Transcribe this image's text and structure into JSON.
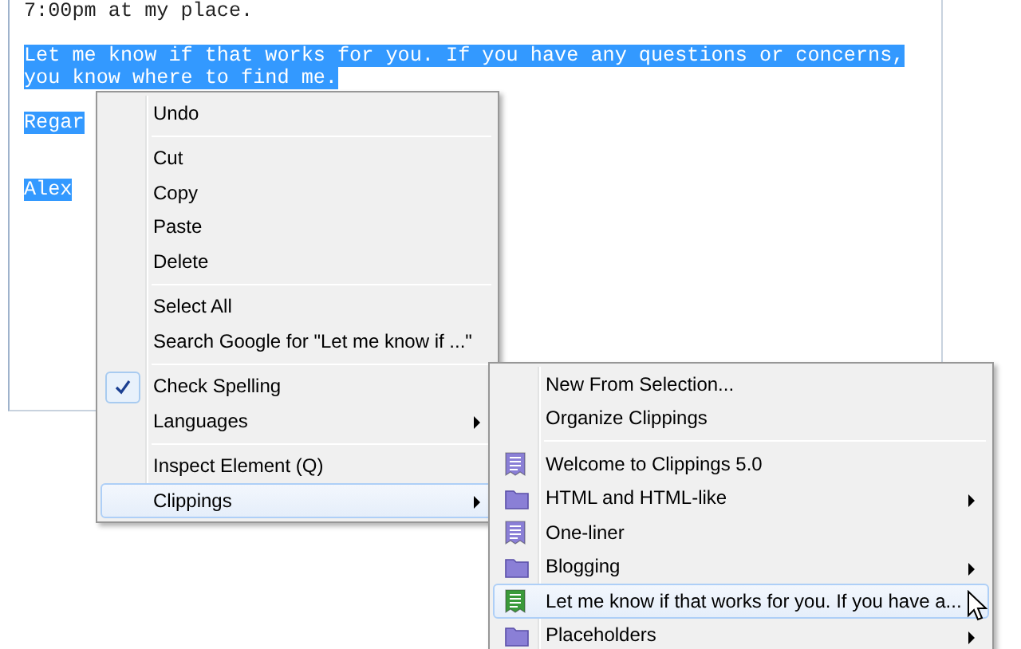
{
  "editor": {
    "lines": [
      {
        "kind": "text",
        "text": "7:00pm at my place.",
        "selected": false
      },
      {
        "kind": "blank"
      },
      {
        "kind": "text",
        "text": "Let me know if that works for you. If you have any questions or concerns,",
        "selected": true
      },
      {
        "kind": "text",
        "text": "you know where to find me.",
        "selected": true
      },
      {
        "kind": "blank"
      },
      {
        "kind": "text",
        "text": "Regar",
        "selected": true
      },
      {
        "kind": "blank"
      },
      {
        "kind": "blank"
      },
      {
        "kind": "text",
        "text": "Alex",
        "selected": true
      }
    ]
  },
  "context_menu": {
    "items": [
      {
        "kind": "item",
        "label": "Undo",
        "checked": false,
        "submenu": false,
        "selected": false
      },
      {
        "kind": "separator"
      },
      {
        "kind": "item",
        "label": "Cut",
        "checked": false,
        "submenu": false,
        "selected": false
      },
      {
        "kind": "item",
        "label": "Copy",
        "checked": false,
        "submenu": false,
        "selected": false
      },
      {
        "kind": "item",
        "label": "Paste",
        "checked": false,
        "submenu": false,
        "selected": false
      },
      {
        "kind": "item",
        "label": "Delete",
        "checked": false,
        "submenu": false,
        "selected": false
      },
      {
        "kind": "separator"
      },
      {
        "kind": "item",
        "label": "Select All",
        "checked": false,
        "submenu": false,
        "selected": false
      },
      {
        "kind": "item",
        "label": "Search Google for \"Let me know if ...\"",
        "checked": false,
        "submenu": false,
        "selected": false
      },
      {
        "kind": "separator"
      },
      {
        "kind": "item",
        "label": "Check Spelling",
        "checked": true,
        "submenu": false,
        "selected": false
      },
      {
        "kind": "item",
        "label": "Languages",
        "checked": false,
        "submenu": true,
        "selected": false
      },
      {
        "kind": "separator"
      },
      {
        "kind": "item",
        "label": "Inspect Element (Q)",
        "checked": false,
        "submenu": false,
        "selected": false
      },
      {
        "kind": "item",
        "label": "Clippings",
        "checked": false,
        "submenu": true,
        "selected": true
      }
    ]
  },
  "clippings_menu": {
    "items": [
      {
        "kind": "item",
        "label": "New From Selection...",
        "submenu": false,
        "selected": false
      },
      {
        "kind": "item",
        "label": "Organize Clippings",
        "submenu": false,
        "selected": false
      },
      {
        "kind": "separator"
      },
      {
        "kind": "clipping",
        "label": "Welcome to Clippings 5.0",
        "color": "#8a7fd6",
        "submenu": false,
        "selected": false
      },
      {
        "kind": "folder",
        "label": "HTML and HTML-like",
        "color": "#8a7fd6",
        "submenu": true,
        "selected": false
      },
      {
        "kind": "clipping",
        "label": "One-liner",
        "color": "#8a7fd6",
        "submenu": false,
        "selected": false
      },
      {
        "kind": "folder",
        "label": "Blogging",
        "color": "#8a7fd6",
        "submenu": true,
        "selected": false
      },
      {
        "kind": "clipping",
        "label": "Let me know if that works for you. If you have a...",
        "color": "#3a9a3a",
        "submenu": false,
        "selected": true
      },
      {
        "kind": "folder",
        "label": "Placeholders",
        "color": "#8a7fd6",
        "submenu": true,
        "selected": false
      }
    ]
  }
}
